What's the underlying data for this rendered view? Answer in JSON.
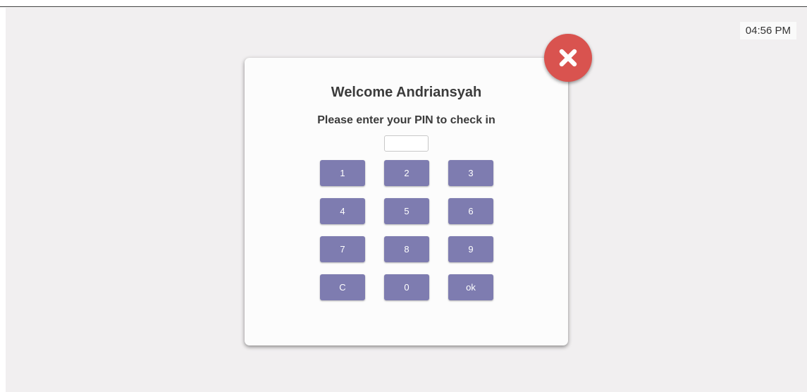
{
  "clock": {
    "time": "04:56 PM"
  },
  "dialog": {
    "title": "Welcome Andriansyah",
    "subtitle": "Please enter your PIN to check in",
    "pin": {
      "value": "",
      "placeholder": ""
    },
    "keys": [
      "1",
      "2",
      "3",
      "4",
      "5",
      "6",
      "7",
      "8",
      "9",
      "C",
      "0",
      "ok"
    ]
  },
  "close": {
    "icon": "close-icon"
  },
  "colors": {
    "backdrop": "#f1eff0",
    "key": "#7e7cb0",
    "close": "#d9534f",
    "text": "#3b3b3b"
  }
}
